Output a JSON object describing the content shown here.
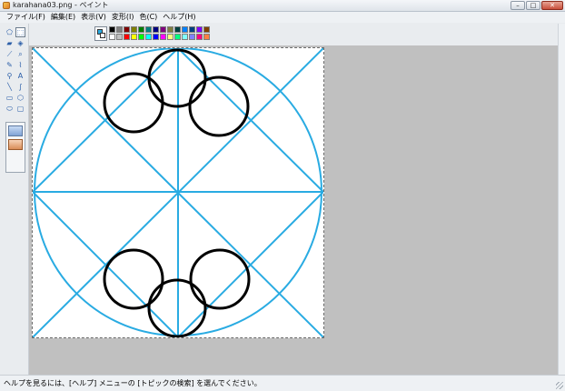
{
  "window": {
    "title": "karahana03.png - ペイント",
    "icon": "paint-app-icon",
    "controls": {
      "minimize": "–",
      "maximize": "□",
      "close": "✕"
    }
  },
  "menu": [
    {
      "label": "ファイル(F)"
    },
    {
      "label": "編集(E)"
    },
    {
      "label": "表示(V)"
    },
    {
      "label": "変形(I)"
    },
    {
      "label": "色(C)"
    },
    {
      "label": "ヘルプ(H)"
    }
  ],
  "tools": [
    {
      "name": "free-select-icon",
      "glyph": "⬠"
    },
    {
      "name": "rect-select-icon",
      "glyph": "⬚",
      "selected": true
    },
    {
      "name": "eraser-icon",
      "glyph": "▰"
    },
    {
      "name": "fill-icon",
      "glyph": "◈"
    },
    {
      "name": "color-picker-icon",
      "glyph": "⟋"
    },
    {
      "name": "magnifier-icon",
      "glyph": "⌕"
    },
    {
      "name": "pencil-icon",
      "glyph": "✎"
    },
    {
      "name": "brush-icon",
      "glyph": "⌇"
    },
    {
      "name": "airbrush-icon",
      "glyph": "⚲"
    },
    {
      "name": "text-icon",
      "glyph": "A"
    },
    {
      "name": "line-icon",
      "glyph": "╲"
    },
    {
      "name": "curve-icon",
      "glyph": "∫"
    },
    {
      "name": "rectangle-icon",
      "glyph": "▭"
    },
    {
      "name": "polygon-icon",
      "glyph": "⬡"
    },
    {
      "name": "ellipse-icon",
      "glyph": "⬭"
    },
    {
      "name": "rounded-rect-icon",
      "glyph": "▢"
    }
  ],
  "palette": {
    "foreground": "#29abe2",
    "background": "#ffffff",
    "colors": [
      "#000000",
      "#808080",
      "#800000",
      "#808000",
      "#008000",
      "#008080",
      "#000080",
      "#800080",
      "#808040",
      "#004040",
      "#0080ff",
      "#004080",
      "#8000ff",
      "#804000",
      "#ffffff",
      "#c0c0c0",
      "#ff0000",
      "#ffff00",
      "#00ff00",
      "#00ffff",
      "#0000ff",
      "#ff00ff",
      "#ffff80",
      "#00ff80",
      "#80ffff",
      "#8080ff",
      "#ff0080",
      "#ff8040"
    ]
  },
  "drawing": {
    "blue": "#29abe2",
    "black": "#000000"
  },
  "status": {
    "help_text": "ヘルプを見るには、[ヘルプ] メニューの [トピックの検索] を選んでください。"
  }
}
